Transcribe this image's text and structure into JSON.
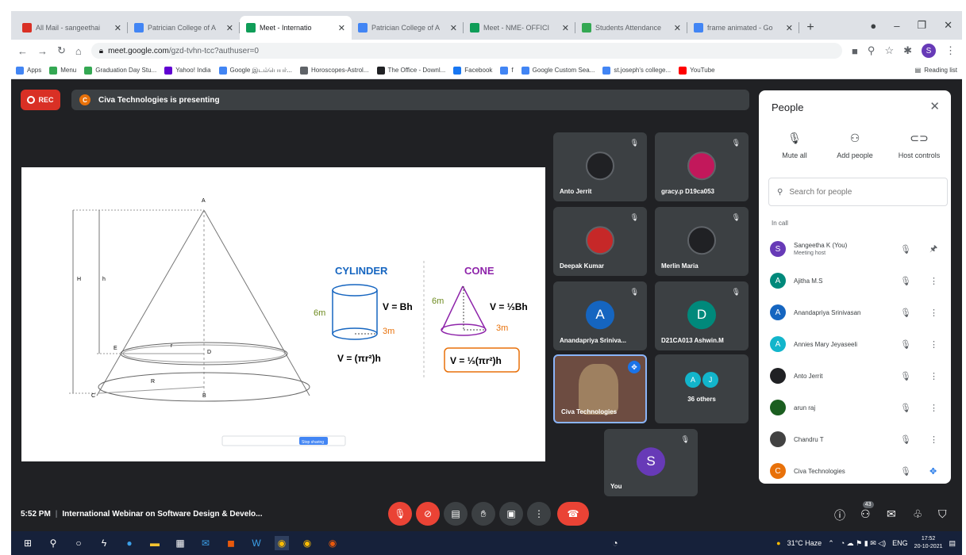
{
  "browser": {
    "tabs": [
      {
        "label": "All Mail - sangeethai",
        "color": "#d93025",
        "active": false
      },
      {
        "label": "Patrician College of A",
        "color": "#4285f4",
        "active": false
      },
      {
        "label": "Meet - Internatio",
        "color": "#0f9d58",
        "active": true
      },
      {
        "label": "Patrician College of A",
        "color": "#4285f4",
        "active": false
      },
      {
        "label": "Meet - NME- OFFICI",
        "color": "#0f9d58",
        "active": false
      },
      {
        "label": "Students Attendance",
        "color": "#34a853",
        "active": false
      },
      {
        "label": "frame animated - Go",
        "color": "#4285f4",
        "active": false
      }
    ],
    "url_host": "meet.google.com",
    "url_path": "/gzd-tvhn-tcc?authuser=0",
    "profile_initial": "S",
    "bookmarks": [
      {
        "label": "Apps",
        "color": "#4285f4"
      },
      {
        "label": "Menu",
        "color": "#34a853"
      },
      {
        "label": "Graduation Day Stu...",
        "color": "#34a853"
      },
      {
        "label": "Yahoo! India",
        "color": "#6001d2"
      },
      {
        "label": "Google இடம்பெயர்...",
        "color": "#4285f4"
      },
      {
        "label": "Horoscopes-Astrol...",
        "color": "#5f6368"
      },
      {
        "label": "The Office - Downl...",
        "color": "#202124"
      },
      {
        "label": "Facebook",
        "color": "#1877f2"
      },
      {
        "label": "f",
        "color": "#4285f4"
      },
      {
        "label": "Google Custom Sea...",
        "color": "#4285f4"
      },
      {
        "label": "st.joseph's college...",
        "color": "#4285f4"
      },
      {
        "label": "YouTube",
        "color": "#ff0000"
      }
    ],
    "reading_list": "Reading list"
  },
  "meet": {
    "rec_label": "REC",
    "presenting_text": "Civa Technologies is presenting",
    "presenter_initial": "C",
    "tiles": [
      {
        "name": "Anto Jerrit",
        "initial": "",
        "kind": "pic",
        "color": "#202124"
      },
      {
        "name": "gracy.p D19ca053",
        "initial": "",
        "kind": "pic",
        "color": "#c2185b"
      },
      {
        "name": "Deepak Kumar",
        "initial": "",
        "kind": "pic",
        "color": "#c62828"
      },
      {
        "name": "Merlin Maria",
        "initial": "",
        "kind": "pic",
        "color": "#202124"
      },
      {
        "name": "Anandapriya Sriniva...",
        "initial": "A",
        "kind": "letter",
        "color": "#1565c0"
      },
      {
        "name": "D21CA013 Ashwin.M",
        "initial": "D",
        "kind": "letter",
        "color": "#00897b"
      },
      {
        "name": "Civa Technologies",
        "initial": "",
        "kind": "video",
        "color": "#6d4c41"
      },
      {
        "name": "36 others",
        "initial": "A J",
        "kind": "others",
        "color": "#12b5cb"
      },
      {
        "name": "You",
        "initial": "S",
        "kind": "letter",
        "color": "#673ab7"
      }
    ],
    "slide": {
      "cylinder_title": "CYLINDER",
      "cone_title": "CONE",
      "cyl_formula": "V = Bh",
      "cyl_formula2": "V = (πr²)h",
      "cone_formula": "V = ⅓Bh",
      "cone_formula2": "V = ⅓(πr²)h",
      "cyl_height": "6m",
      "cyl_radius": "3m",
      "cone_height": "6m",
      "cone_radius": "3m",
      "label_H": "H",
      "label_h": "h",
      "label_A": "A",
      "label_E": "E",
      "label_D": "D",
      "label_r": "r",
      "label_R": "R",
      "label_C": "C",
      "label_B": "B",
      "share_button": "Stop sharing"
    }
  },
  "people": {
    "title": "People",
    "actions": [
      {
        "label": "Mute all",
        "icon": "mute-all-icon"
      },
      {
        "label": "Add people",
        "icon": "add-people-icon"
      },
      {
        "label": "Host controls",
        "icon": "host-controls-icon"
      }
    ],
    "search_placeholder": "Search for people",
    "section": "In call",
    "list": [
      {
        "name": "Sangeetha K (You)",
        "sub": "Meeting host",
        "initial": "S",
        "color": "#673ab7",
        "right": "pin"
      },
      {
        "name": "Ajitha M.S",
        "sub": "",
        "initial": "A",
        "color": "#00897b",
        "right": "more"
      },
      {
        "name": "Anandapriya Srinivasan",
        "sub": "",
        "initial": "A",
        "color": "#1565c0",
        "right": "more"
      },
      {
        "name": "Annies Mary Jeyaseeli",
        "sub": "",
        "initial": "A",
        "color": "#12b5cb",
        "right": "more"
      },
      {
        "name": "Anto Jerrit",
        "sub": "",
        "initial": "",
        "color": "#202124",
        "right": "more"
      },
      {
        "name": "arun raj",
        "sub": "",
        "initial": "",
        "color": "#1b5e20",
        "right": "more"
      },
      {
        "name": "Chandru T",
        "sub": "",
        "initial": "",
        "color": "#424242",
        "right": "more"
      },
      {
        "name": "Civa Technologies",
        "sub": "",
        "initial": "C",
        "color": "#e8710a",
        "right": "present"
      }
    ]
  },
  "controls": {
    "time": "5:52 PM",
    "meeting_title": "International Webinar on Software Design & Develo...",
    "people_count": "43"
  },
  "taskbar": {
    "weather": "31°C Haze",
    "lang": "ENG",
    "clock_time": "17:52",
    "clock_date": "20-10-2021"
  }
}
